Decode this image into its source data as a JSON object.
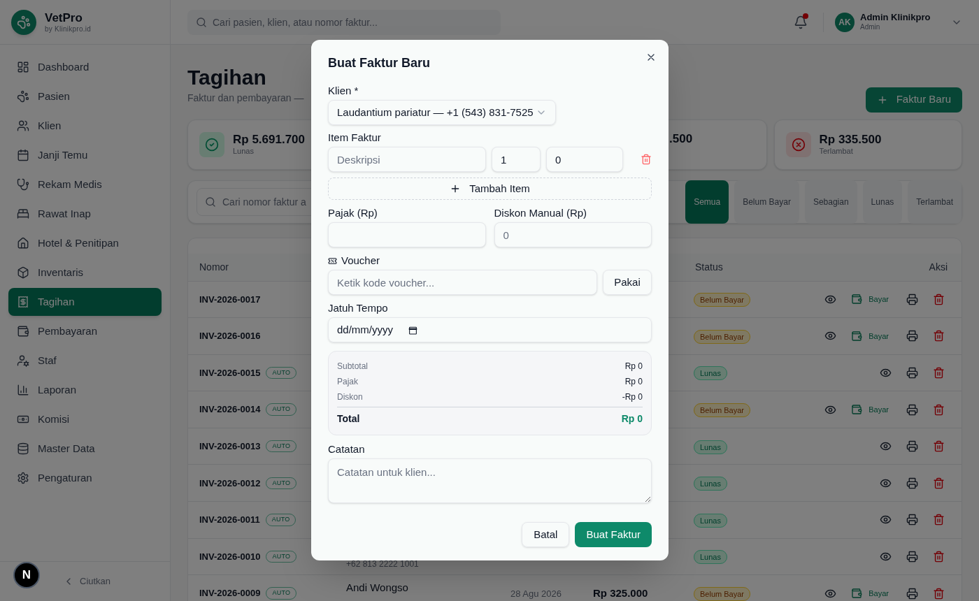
{
  "sidebar": {
    "brand": "VetPro",
    "tagline": "by Klinikpro.id",
    "items": [
      {
        "label": "Dashboard",
        "selected": false
      },
      {
        "label": "Pasien",
        "selected": false
      },
      {
        "label": "Klien",
        "selected": false
      },
      {
        "label": "Janji Temu",
        "selected": false
      },
      {
        "label": "Rekam Medis",
        "selected": false
      },
      {
        "label": "Rawat Inap",
        "selected": false
      },
      {
        "label": "Hotel & Penitipan",
        "selected": false
      },
      {
        "label": "Inventaris",
        "selected": false
      },
      {
        "label": "Tagihan",
        "selected": true
      },
      {
        "label": "Pembayaran",
        "selected": false
      },
      {
        "label": "Staf",
        "selected": false
      },
      {
        "label": "Laporan",
        "selected": false
      },
      {
        "label": "Komisi",
        "selected": false
      },
      {
        "label": "Master Data",
        "selected": false
      },
      {
        "label": "Pengaturan",
        "selected": false
      }
    ],
    "collapse": "Ciutkan"
  },
  "dev_badge": "N",
  "header": {
    "search_placeholder": "Cari pasien, klien, atau nomor faktur...",
    "unread": true,
    "user": {
      "initials": "AK",
      "name": "Admin Klinikpro",
      "role": "Admin"
    }
  },
  "page": {
    "title": "Tagihan",
    "subtitle": "Faktur dan pembayaran —",
    "new_button": "Faktur Baru"
  },
  "stats": [
    {
      "kind": "paid",
      "value": "Rp 5.691.700",
      "label": "Lunas"
    },
    {
      "kind": "partial",
      "value": ".500"
    },
    {
      "kind": "overdue",
      "value": "Rp 335.500",
      "label": "Terlambat"
    }
  ],
  "filter": {
    "search_placeholder": "Cari nomor faktur a",
    "tabs": [
      {
        "label": "Semua",
        "selected": true
      },
      {
        "label": "Belum Bayar",
        "selected": false
      },
      {
        "label": "Sebagian",
        "selected": false
      },
      {
        "label": "Lunas",
        "selected": false
      },
      {
        "label": "Terlambat",
        "selected": false
      }
    ]
  },
  "table": {
    "columns": {
      "number": "Nomor",
      "status": "Status",
      "actions": "Aksi"
    },
    "rows": [
      {
        "number": "INV-2026-0017",
        "auto": false,
        "status": "Belum Bayar",
        "paid": false,
        "pay_action": "Bayar"
      },
      {
        "number": "INV-2026-0016",
        "auto": false,
        "status": "Belum Bayar",
        "paid": false,
        "pay_action": "Bayar"
      },
      {
        "number": "INV-2026-0015",
        "auto": true,
        "auto_label": "AUTO",
        "status": "Lunas",
        "paid": true
      },
      {
        "number": "INV-2026-0014",
        "auto": true,
        "auto_label": "AUTO",
        "status": "Belum Bayar",
        "paid": false,
        "pay_action": "Bayar"
      },
      {
        "number": "INV-2026-0013",
        "auto": true,
        "auto_label": "AUTO",
        "status": "Lunas",
        "paid": true
      },
      {
        "number": "INV-2026-0012",
        "auto": true,
        "auto_label": "AUTO",
        "status": "Lunas",
        "paid": true
      },
      {
        "number": "INV-2026-0011",
        "auto": true,
        "auto_label": "AUTO",
        "status": "Lunas",
        "paid": true
      },
      {
        "number": "INV-2026-0010",
        "auto": true,
        "auto_label": "AUTO",
        "phone": "+62 813 2222 1001",
        "status": "Lunas",
        "paid": true
      },
      {
        "number": "INV-2026-0009",
        "auto": true,
        "auto_label": "AUTO",
        "client": "Andi Wongso",
        "date": "28 Agu 2026",
        "amount": "Rp 325.000",
        "status": "Belum Bayar",
        "paid": false,
        "pay_action": "Bayar"
      }
    ]
  },
  "modal": {
    "title": "Buat Faktur Baru",
    "client_label": "Klien *",
    "client_value": "Laudantium pariatur — +1 (543) 831-7525",
    "items_label": "Item Faktur",
    "item": {
      "description_placeholder": "Deskripsi",
      "qty": "1",
      "price": "0"
    },
    "add_item": "Tambah Item",
    "tax_label": "Pajak (Rp)",
    "discount_label": "Diskon Manual (Rp)",
    "discount_placeholder": "0",
    "voucher_label": "Voucher",
    "voucher_placeholder": "Ketik kode voucher...",
    "voucher_button": "Pakai",
    "due_label": "Jatuh Tempo",
    "due_placeholder": "dd/mm/yyyy",
    "summary": [
      {
        "label": "Subtotal",
        "value": "Rp 0"
      },
      {
        "label": "Pajak",
        "value": "Rp 0"
      },
      {
        "label": "Diskon",
        "value": "-Rp 0"
      }
    ],
    "total": {
      "label": "Total",
      "value": "Rp 0"
    },
    "notes_label": "Catatan",
    "notes_placeholder": "Catatan untuk klien...",
    "cancel": "Batal",
    "submit": "Buat Faktur"
  }
}
